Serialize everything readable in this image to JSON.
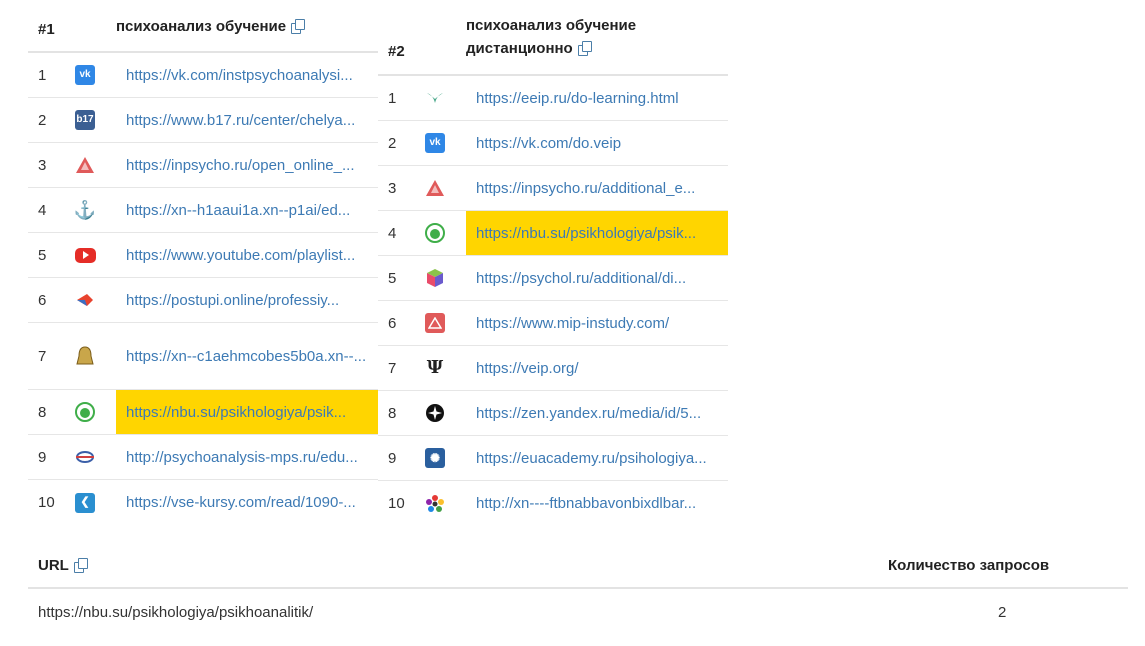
{
  "serp1": {
    "number": "#1",
    "query": "психоанализ обучение",
    "rows": [
      {
        "pos": "1",
        "icon": "vk-icon",
        "url": "https://vk.com/instpsychoanalysi...",
        "highlighted": false
      },
      {
        "pos": "2",
        "icon": "b17-icon",
        "url": "https://www.b17.ru/center/chelya...",
        "highlighted": false
      },
      {
        "pos": "3",
        "icon": "inpsycho-icon",
        "url": "https://inpsycho.ru/open_online_...",
        "highlighted": false
      },
      {
        "pos": "4",
        "icon": "anchor-icon",
        "url": "https://xn--h1aaui1a.xn--p1ai/ed...",
        "highlighted": false
      },
      {
        "pos": "5",
        "icon": "youtube-icon",
        "url": "https://www.youtube.com/playlist...",
        "highlighted": false
      },
      {
        "pos": "6",
        "icon": "postupi-icon",
        "url": "https://postupi.online/professiy...",
        "highlighted": false
      },
      {
        "pos": "7",
        "icon": "bell-icon",
        "url": "https://xn--c1aehmcobes5b0a.xn--...",
        "highlighted": false
      },
      {
        "pos": "8",
        "icon": "nbu-icon",
        "url": "https://nbu.su/psikhologiya/psik...",
        "highlighted": true
      },
      {
        "pos": "9",
        "icon": "mps-icon",
        "url": "http://psychoanalysis-mps.ru/edu...",
        "highlighted": false
      },
      {
        "pos": "10",
        "icon": "vse-kursy-icon",
        "url": "https://vse-kursy.com/read/1090-...",
        "highlighted": false
      }
    ]
  },
  "serp2": {
    "number": "#2",
    "query": "психоанализ обучение дистанционно",
    "rows": [
      {
        "pos": "1",
        "icon": "eeip-icon",
        "url": "https://eeip.ru/do-learning.html",
        "highlighted": false
      },
      {
        "pos": "2",
        "icon": "vk-icon",
        "url": "https://vk.com/do.veip",
        "highlighted": false
      },
      {
        "pos": "3",
        "icon": "inpsycho-icon",
        "url": "https://inpsycho.ru/additional_e...",
        "highlighted": false
      },
      {
        "pos": "4",
        "icon": "nbu-icon",
        "url": "https://nbu.su/psikhologiya/psik...",
        "highlighted": true
      },
      {
        "pos": "5",
        "icon": "cube-icon",
        "url": "https://psychol.ru/additional/di...",
        "highlighted": false
      },
      {
        "pos": "6",
        "icon": "mip-icon",
        "url": "https://www.mip-instudy.com/",
        "highlighted": false
      },
      {
        "pos": "7",
        "icon": "psi-icon",
        "url": "https://veip.org/",
        "highlighted": false
      },
      {
        "pos": "8",
        "icon": "zen-icon",
        "url": "https://zen.yandex.ru/media/id/5...",
        "highlighted": false
      },
      {
        "pos": "9",
        "icon": "euacademy-icon",
        "url": "https://euacademy.ru/psihologiya...",
        "highlighted": false
      },
      {
        "pos": "10",
        "icon": "flower-icon",
        "url": "http://xn----ftbnabbavonbixdlbar...",
        "highlighted": false
      }
    ]
  },
  "url_table": {
    "col_url": "URL",
    "col_count": "Количество запросов",
    "rows": [
      {
        "url": "https://nbu.su/psikhologiya/psikhoanalitik/",
        "count": "2"
      }
    ]
  },
  "colors": {
    "link": "#3d7ab4",
    "highlight": "#ffd500",
    "divider": "#e6e6e6"
  }
}
